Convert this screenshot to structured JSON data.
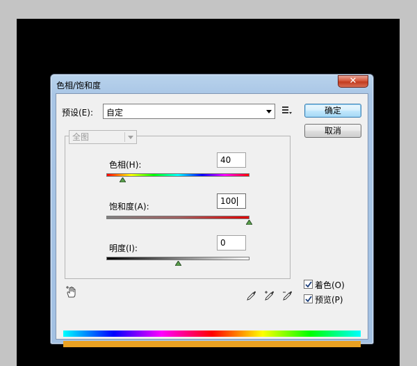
{
  "window": {
    "title": "色相/饱和度",
    "close_glyph": "✕"
  },
  "preset": {
    "label": "预设(E):",
    "value": "自定"
  },
  "buttons": {
    "ok": "确定",
    "cancel": "取消"
  },
  "channel": {
    "value": "全图"
  },
  "sliders": [
    {
      "label": "色相(H):",
      "value": "40",
      "min": -180,
      "max": 180
    },
    {
      "label": "饱和度(A):",
      "value": "100",
      "min": -100,
      "max": 100
    },
    {
      "label": "明度(I):",
      "value": "0",
      "min": -100,
      "max": 100
    }
  ],
  "options": {
    "colorize": {
      "label": "着色(O)",
      "checked": true
    },
    "preview": {
      "label": "预览(P)",
      "checked": true
    }
  },
  "colors": {
    "accent_orange": "#e9a122",
    "default_button_border": "#3c7fb1"
  },
  "icons": {
    "close": "close-icon",
    "preset_menu": "preset-menu-icon",
    "hand": "targeted-adjustment-hand-icon",
    "droppers": [
      "eyedropper-icon",
      "eyedropper-plus-icon",
      "eyedropper-minus-icon"
    ]
  }
}
